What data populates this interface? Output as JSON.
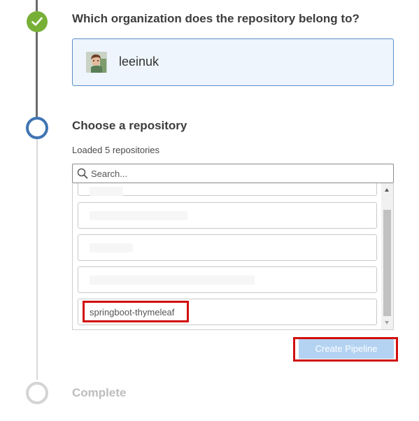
{
  "steps": {
    "organization": {
      "title": "Which organization does the repository belong to?",
      "status": "completed"
    },
    "repository": {
      "title": "Choose a repository",
      "status": "active"
    },
    "complete": {
      "title": "Complete",
      "status": "pending"
    }
  },
  "organization": {
    "name": "leeinuk",
    "avatar_icon": "user-avatar"
  },
  "repository_picker": {
    "loaded_text": "Loaded 5 repositories",
    "search_placeholder": "Search...",
    "search_value": "",
    "visible_repositories": [
      "",
      "",
      "",
      "",
      "springboot-thymeleaf"
    ],
    "selected_repository": "springboot-thymeleaf"
  },
  "actions": {
    "create_pipeline_label": "Create Pipeline",
    "create_pipeline_enabled": false
  },
  "colors": {
    "completed": "#78b037",
    "active": "#3f74b3",
    "pending": "#d4d4d4",
    "selection_card_bg": "#eef5fd",
    "selection_card_border": "#5a8fc8",
    "button_disabled": "#b4d3f2",
    "highlight": "#d10f0f"
  }
}
